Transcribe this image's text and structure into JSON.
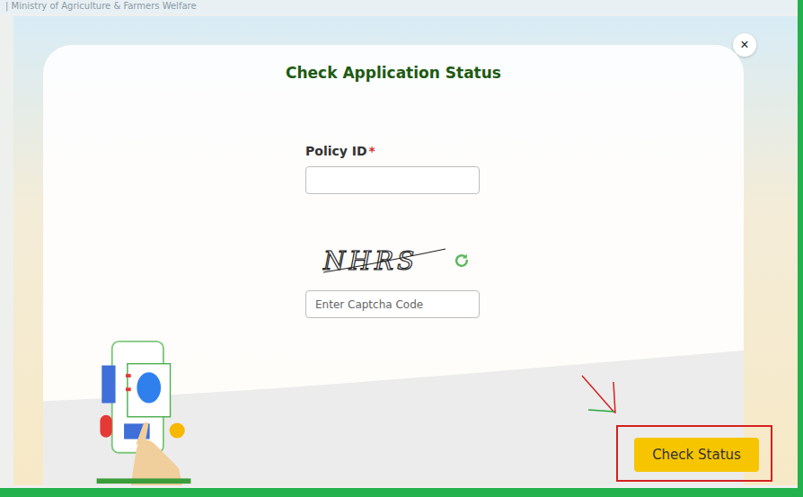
{
  "page": {
    "header_text": "| Ministry of Agriculture & Farmers Welfare"
  },
  "dialog": {
    "title": "Check Application Status",
    "close": "×"
  },
  "form": {
    "policy_id": {
      "label": "Policy ID",
      "required_mark": "*",
      "value": ""
    },
    "captcha": {
      "code": "NHRS",
      "placeholder": "Enter Captcha Code",
      "value": ""
    }
  },
  "buttons": [
    {
      "label": "Check Status",
      "highlighted": true
    }
  ]
}
